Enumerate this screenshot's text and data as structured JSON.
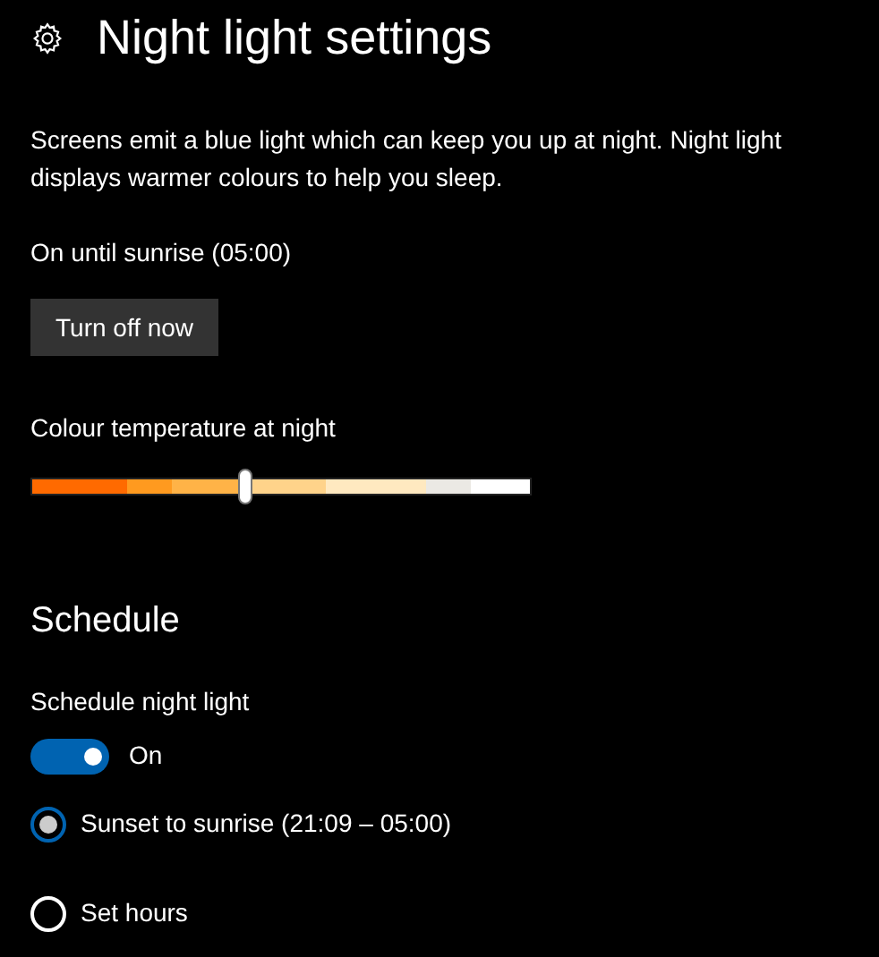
{
  "title": "Night light settings",
  "description": "Screens emit a blue light which can keep you up at night. Night light displays warmer colours to help you sleep.",
  "status": "On until sunrise (05:00)",
  "turn_off_button": "Turn off now",
  "temperature": {
    "label": "Colour temperature at night",
    "level": 0.43
  },
  "schedule": {
    "heading": "Schedule",
    "toggle_label": "Schedule night light",
    "on": true,
    "state_text": "On",
    "options": [
      {
        "label": "Sunset to sunrise (21:09 – 05:00)",
        "selected": true
      },
      {
        "label": "Set hours",
        "selected": false
      }
    ]
  }
}
